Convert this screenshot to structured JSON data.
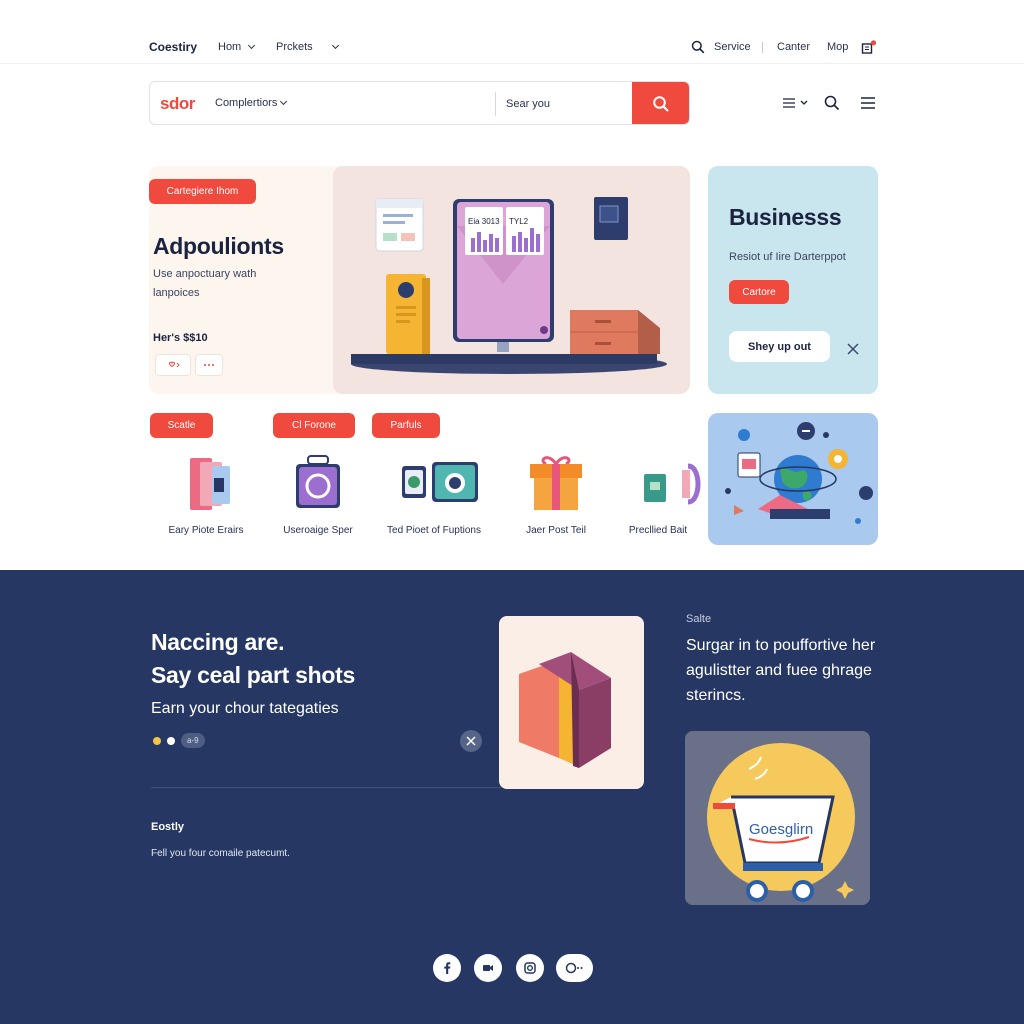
{
  "nav": {
    "brand": "Coestiry",
    "items": [
      {
        "label": "Hom"
      },
      {
        "label": "Prckets"
      }
    ],
    "right": {
      "service": "Service",
      "center": "Canter",
      "map": "Mop"
    }
  },
  "search": {
    "logo": "sdor",
    "category": "Complertiors",
    "placeholder": "Sear you"
  },
  "hero": {
    "badge": "Cartegiere Ihom",
    "title": "Adpoulionts",
    "desc": "Use anpoctuary wath lanpoices",
    "price": "Her's $$10",
    "tiles": {
      "t1": "Eia 3013",
      "t2": "TYL2"
    }
  },
  "business": {
    "title": "Businesss",
    "sub": "Resiot uf Iire Darterppot",
    "button": "Cartore",
    "signup": "Shey up out"
  },
  "filters": [
    {
      "label": "Scatle"
    },
    {
      "label": "Cl Forone"
    },
    {
      "label": "Parfuls"
    }
  ],
  "categories": [
    {
      "label": "Eary Piote Erairs"
    },
    {
      "label": "Useroaige Sper"
    },
    {
      "label": "Ted Pioet of Fuptions"
    },
    {
      "label": "Jaer Post Teil"
    },
    {
      "label": "Precllied Bait"
    }
  ],
  "footer": {
    "headline1": "Naccing are.",
    "headline2": "Say ceal part shots",
    "earn": "Earn your chour tategaties",
    "pill": "a-9",
    "easy_title": "Eostly",
    "easy_desc": "Fell you four comaile patecumt.",
    "sale_label": "Salte",
    "sale_text": "Surgar in to pouffortive her agulistter and fuee ghrage sterincs.",
    "cart_text": "Goesglirn"
  },
  "colors": {
    "accent": "#ef4a3d",
    "navy": "#253762",
    "sky": "#c9e6ef",
    "blue": "#a9c9ee"
  }
}
